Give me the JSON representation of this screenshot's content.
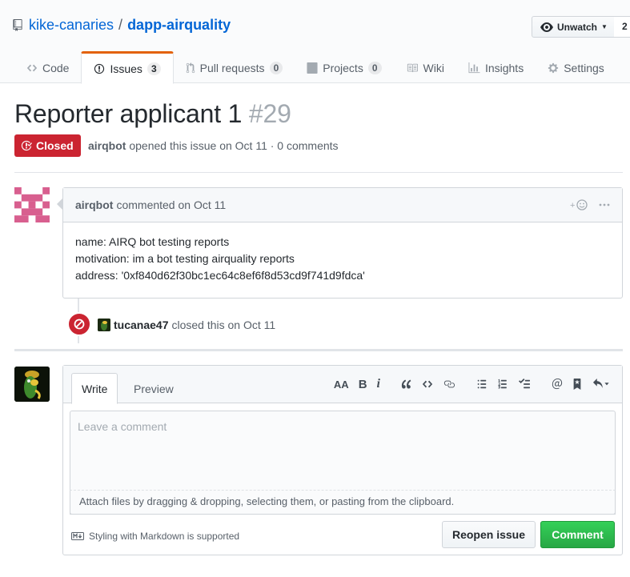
{
  "repo": {
    "owner": "kike-canaries",
    "separator": "/",
    "name": "dapp-airquality",
    "watch_label": "Unwatch",
    "watch_count": "2"
  },
  "tabs": [
    {
      "label": "Code",
      "icon": "code-icon"
    },
    {
      "label": "Issues",
      "count": "3",
      "icon": "issue-opened-icon"
    },
    {
      "label": "Pull requests",
      "count": "0",
      "icon": "git-pull-request-icon"
    },
    {
      "label": "Projects",
      "count": "0",
      "icon": "project-icon"
    },
    {
      "label": "Wiki",
      "icon": "book-icon"
    },
    {
      "label": "Insights",
      "icon": "graph-icon"
    },
    {
      "label": "Settings",
      "icon": "gear-icon"
    }
  ],
  "issue": {
    "title": "Reporter applicant 1",
    "number": "#29",
    "state": "Closed",
    "author": "airqbot",
    "meta_text": "opened this issue on Oct 11 · 0 comments"
  },
  "comment": {
    "author": "airqbot",
    "header_text": "commented on Oct 11",
    "body_lines": [
      "name: AIRQ bot testing reports",
      "motivation: im a bot testing airquality reports",
      "address: '0xf840d62f30bc1ec64c8ef6f8d53cd9f741d9fdca'"
    ]
  },
  "event": {
    "actor": "tucanae47",
    "text": "closed this on Oct 11"
  },
  "form": {
    "write_tab": "Write",
    "preview_tab": "Preview",
    "toolbar": {
      "header": "AA",
      "bold": "B",
      "italic": "i"
    },
    "placeholder": "Leave a comment",
    "attach_text": "Attach files by dragging & dropping, selecting them, or pasting from the clipboard.",
    "markdown_hint": "Styling with Markdown is supported",
    "reopen_label": "Reopen issue",
    "comment_label": "Comment"
  },
  "colors": {
    "link": "#0366d6",
    "closed": "#cb2431",
    "tab_accent": "#e36209",
    "primary_button": "#28a745"
  }
}
